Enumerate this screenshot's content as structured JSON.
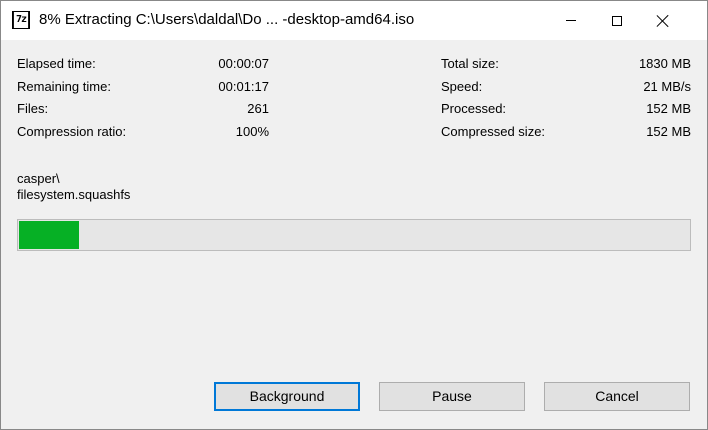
{
  "window": {
    "title": "8% Extracting C:\\Users\\daldal\\Do ... -desktop-amd64.iso",
    "app_icon_text": "7z"
  },
  "stats_left": [
    {
      "label": "Elapsed time:",
      "value": "00:00:07"
    },
    {
      "label": "Remaining time:",
      "value": "00:01:17"
    },
    {
      "label": "Files:",
      "value": "261"
    },
    {
      "label": "Compression ratio:",
      "value": "100%"
    }
  ],
  "stats_right": [
    {
      "label": "Total size:",
      "value": "1830 MB"
    },
    {
      "label": "Speed:",
      "value": "21 MB/s"
    },
    {
      "label": "Processed:",
      "value": "152 MB"
    },
    {
      "label": "Compressed size:",
      "value": "152 MB"
    }
  ],
  "current_item": {
    "folder": "casper\\",
    "file": "filesystem.squashfs"
  },
  "progress": {
    "fraction": 0.09,
    "color": "#06b025"
  },
  "buttons": {
    "background": "Background",
    "pause": "Pause",
    "cancel": "Cancel"
  },
  "colors": {
    "accent": "#0078d7",
    "dialog_bg": "#f0f0f0"
  }
}
